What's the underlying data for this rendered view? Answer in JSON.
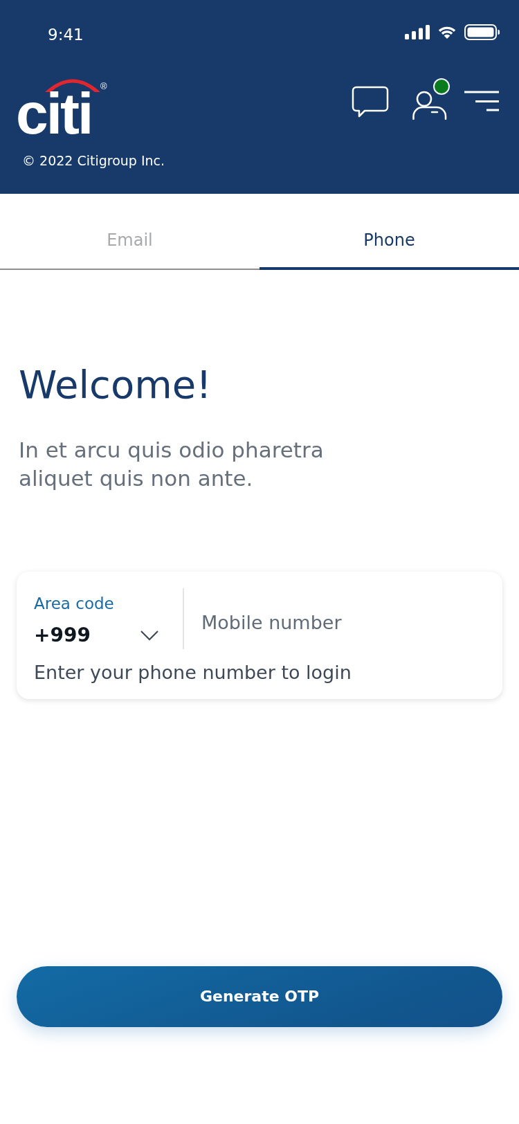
{
  "status_bar": {
    "time": "9:41"
  },
  "header": {
    "logo": {
      "text": "citi",
      "mark": "®"
    },
    "copyright": "© 2022 Citigroup Inc.",
    "profile": {
      "badge": true
    }
  },
  "tabs": [
    {
      "label": "Email",
      "selected": false
    },
    {
      "label": "Phone",
      "selected": true
    }
  ],
  "welcome": {
    "title": "Welcome!",
    "text": "In et arcu quis odio pharetra aliquet quis non ante."
  },
  "phone_form": {
    "area_code": {
      "label": "Area code",
      "value": "+999"
    },
    "mobile_number": {
      "placeholder": "Mobile number"
    },
    "helper": "Enter your phone number to login"
  },
  "primary_button": {
    "label": "Generate OTP"
  }
}
